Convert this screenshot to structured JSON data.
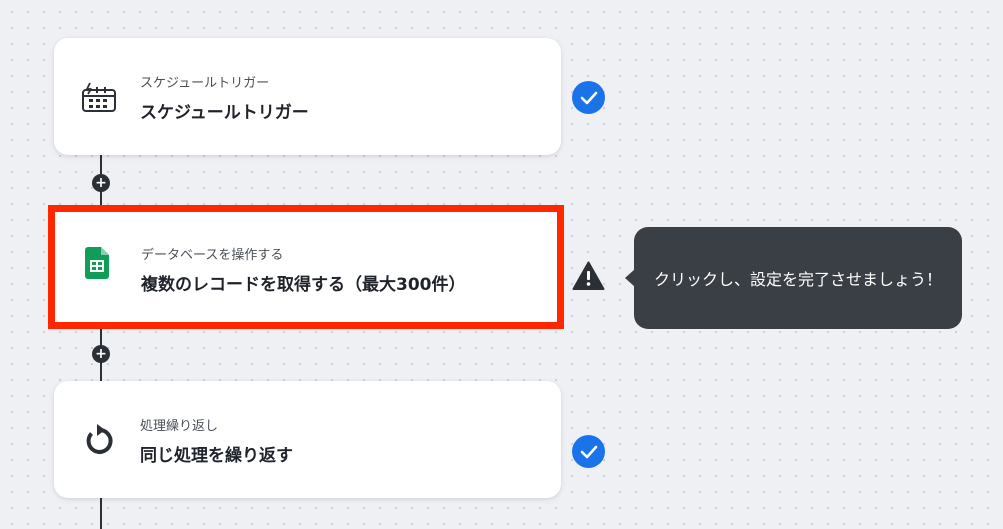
{
  "steps": [
    {
      "subtitle": "スケジュールトリガー",
      "title": "スケジュールトリガー",
      "icon": "calendar-clock-icon",
      "status": "completed"
    },
    {
      "subtitle": "データベースを操作する",
      "title": "複数のレコードを取得する（最大300件）",
      "icon": "google-sheets-icon",
      "status": "warning"
    },
    {
      "subtitle": "処理繰り返し",
      "title": "同じ処理を繰り返す",
      "icon": "loop-icon",
      "status": "completed"
    }
  ],
  "add_step_label": "+",
  "tooltip": {
    "text": "クリックし、設定を完了させましょう！"
  },
  "colors": {
    "check": "#1a73e8",
    "highlight_border": "#ff2600",
    "tooltip_bg": "#3a3e45",
    "sheets_green": "#0f9d58"
  }
}
